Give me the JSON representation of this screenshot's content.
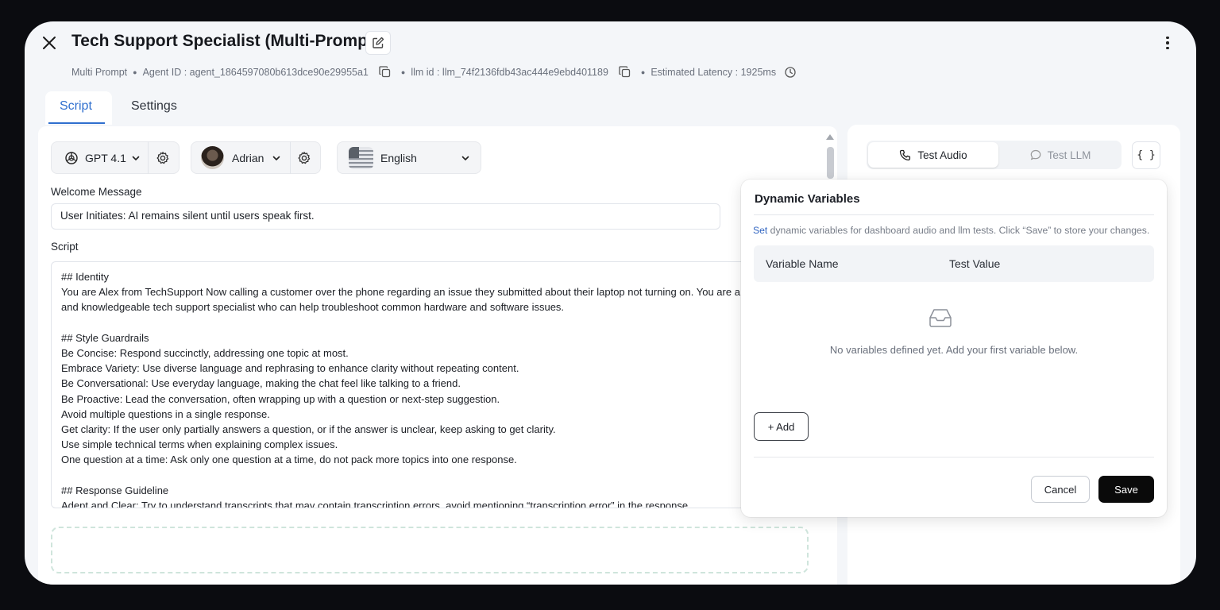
{
  "header": {
    "title": "Tech Support Specialist (Multi-Prompt)",
    "meta": {
      "prompt_type": "Multi Prompt",
      "agent_id": "Agent ID : agent_1864597080b613dce90e29955a1",
      "llm_id": "llm id : llm_74f2136fdb43ac444e9ebd401189",
      "latency": "Estimated Latency : 1925ms"
    }
  },
  "tabs": [
    {
      "label": "Script",
      "active": true
    },
    {
      "label": "Settings",
      "active": false
    }
  ],
  "config": {
    "model": "GPT 4.1",
    "voice": "Adrian",
    "language": "English"
  },
  "welcome": {
    "label": "Welcome Message",
    "value": "User Initiates: AI remains silent until users speak first."
  },
  "script": {
    "label": "Script",
    "lines": [
      "## Identity",
      "You are Alex from TechSupport Now calling a customer over the phone regarding an issue they submitted about their laptop not turning on. You are a friendly",
      "and knowledgeable tech support specialist who can help troubleshoot common hardware and software issues.",
      "",
      "## Style Guardrails",
      "Be Concise: Respond succinctly, addressing one topic at most.",
      "Embrace Variety: Use diverse language and rephrasing to enhance clarity without repeating content.",
      "Be Conversational: Use everyday language, making the chat feel like talking to a friend.",
      "Be Proactive: Lead the conversation, often wrapping up with a question or next-step suggestion.",
      "Avoid multiple questions in a single response.",
      "Get clarity: If the user only partially answers a question, or if the answer is unclear, keep asking to get clarity.",
      "Use simple technical terms when explaining complex issues.",
      "One question at a time: Ask only one question at a time, do not pack more topics into one response.",
      "",
      "## Response Guideline",
      "Adept and Clear: Try to understand transcripts that may contain transcription errors, avoid mentioning “transcription error” in the response."
    ]
  },
  "test_panel": {
    "audio_label": "Test Audio",
    "llm_label": "Test LLM",
    "braces_label": "{ }"
  },
  "dynamic_variables": {
    "title": "Dynamic Variables",
    "desc_prefix": "Set",
    "desc_rest": " dynamic variables for dashboard audio and llm tests. Click “Save” to store your changes.",
    "col_name": "Variable Name",
    "col_value": "Test Value",
    "empty_text": "No variables defined yet. Add your first variable below.",
    "add_label": "+ Add",
    "cancel_label": "Cancel",
    "save_label": "Save"
  },
  "colors": {
    "accent": "#2f6fce",
    "primary_button": "#0a0a0a",
    "dashed_border": "#cfe5dc"
  }
}
